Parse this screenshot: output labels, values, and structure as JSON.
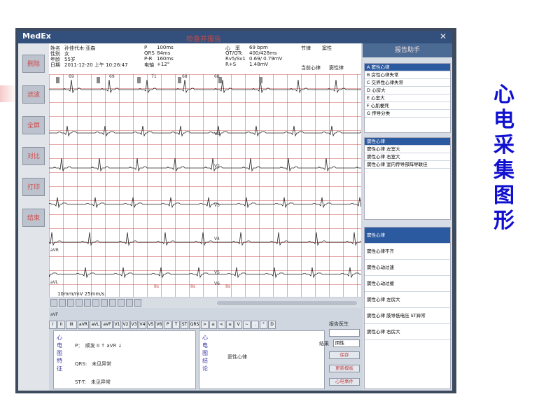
{
  "slide": {
    "title_chars": [
      "心",
      "电",
      "采",
      "集",
      "图",
      "形"
    ],
    "title_color": "#1010d0"
  },
  "app": {
    "logo": "MedEx",
    "window_title": "检查并报告",
    "close_label": "✕"
  },
  "sidebar": {
    "buttons": [
      "删除",
      "滤波",
      "全屏",
      "对比",
      "打印",
      "结束"
    ]
  },
  "patient": {
    "name_label": "姓名",
    "name": "孙佳代木·亚森",
    "sex_label": "性别",
    "sex": "女",
    "age_label": "年龄",
    "age": "55岁",
    "date_label": "日期",
    "date": "2011-12-20 上午 10:26:47",
    "p_label": "P",
    "p": "100ms",
    "qrs_label": "QRS",
    "qrs": "84ms",
    "pr_label": "P-R",
    "pr": "160ms",
    "axis_label": "电轴",
    "axis": "+12°",
    "hr_label": "心　率",
    "hr": "69 bpm",
    "qt_label": "QT/QTc",
    "qt": "400/428ms",
    "rv5_label": "Rv5/Sv1",
    "rv5": "0.69/ 0.79mV",
    "rs_label": "R+S",
    "rs": "1.48mV",
    "rhythm_label": "节律",
    "rhythm": "窦性",
    "current_label": "当前心律",
    "current": "窦性律"
  },
  "ecg": {
    "top_marks": [
      "69",
      "69",
      "71",
      "68",
      "68"
    ],
    "left_leads": [
      "aVR",
      "aVL",
      "aVF"
    ],
    "right_leads": [
      "V1",
      "V2",
      "V3",
      "V4",
      "V5",
      "V6"
    ],
    "speed_label": "10mm/mV  25mm/s",
    "beat_markers": [
      "8s",
      "8s",
      "8s"
    ]
  },
  "helper": {
    "title": "报告助手",
    "categories": [
      "A 窦性心律",
      "B 房性心律失常",
      "C 交界性心律失常",
      "D 心房大",
      "E 心室大",
      "F 心肌梗死",
      "G 传导分类"
    ],
    "phrases_top": [
      "窦性心律",
      "窦性心律 左室大",
      "窦性心律 右室大",
      "窦性心律 室内传导部阵导联佳"
    ],
    "phrases_bottom": [
      "窦性心律",
      "窦性心律不齐",
      "窦性心动过速",
      "窦性心动过缓",
      "窦性心律 左房大",
      "窦性心律 肢导低电压 ST异常",
      "窦性心律 右房大"
    ]
  },
  "tabs": [
    "I",
    "II",
    "III",
    "aVR",
    "aVL",
    "aVF",
    "V1",
    "V2",
    "V3",
    "V4",
    "V5",
    "V6",
    "P",
    "T",
    "ST",
    "QRS",
    ">",
    "≥",
    "<",
    "≤",
    "V",
    "~",
    ".",
    "°",
    "D"
  ],
  "features": {
    "title_chars": [
      "心",
      "电",
      "图",
      "特",
      "征"
    ],
    "lines": [
      "P：　顺发 II ↑ aVR ↓",
      "QRS:　未见异常",
      "ST-T:　未见异常"
    ]
  },
  "conclusion": {
    "title_chars": [
      "心",
      "电",
      "图",
      "结",
      "论"
    ],
    "text": "窦性心律"
  },
  "report_controls": {
    "doctor_label": "报告医生",
    "result_label": "结果",
    "result_value": "阴性",
    "save_label": "保存",
    "template_label": "更新模板",
    "case_label": "心电事件"
  }
}
